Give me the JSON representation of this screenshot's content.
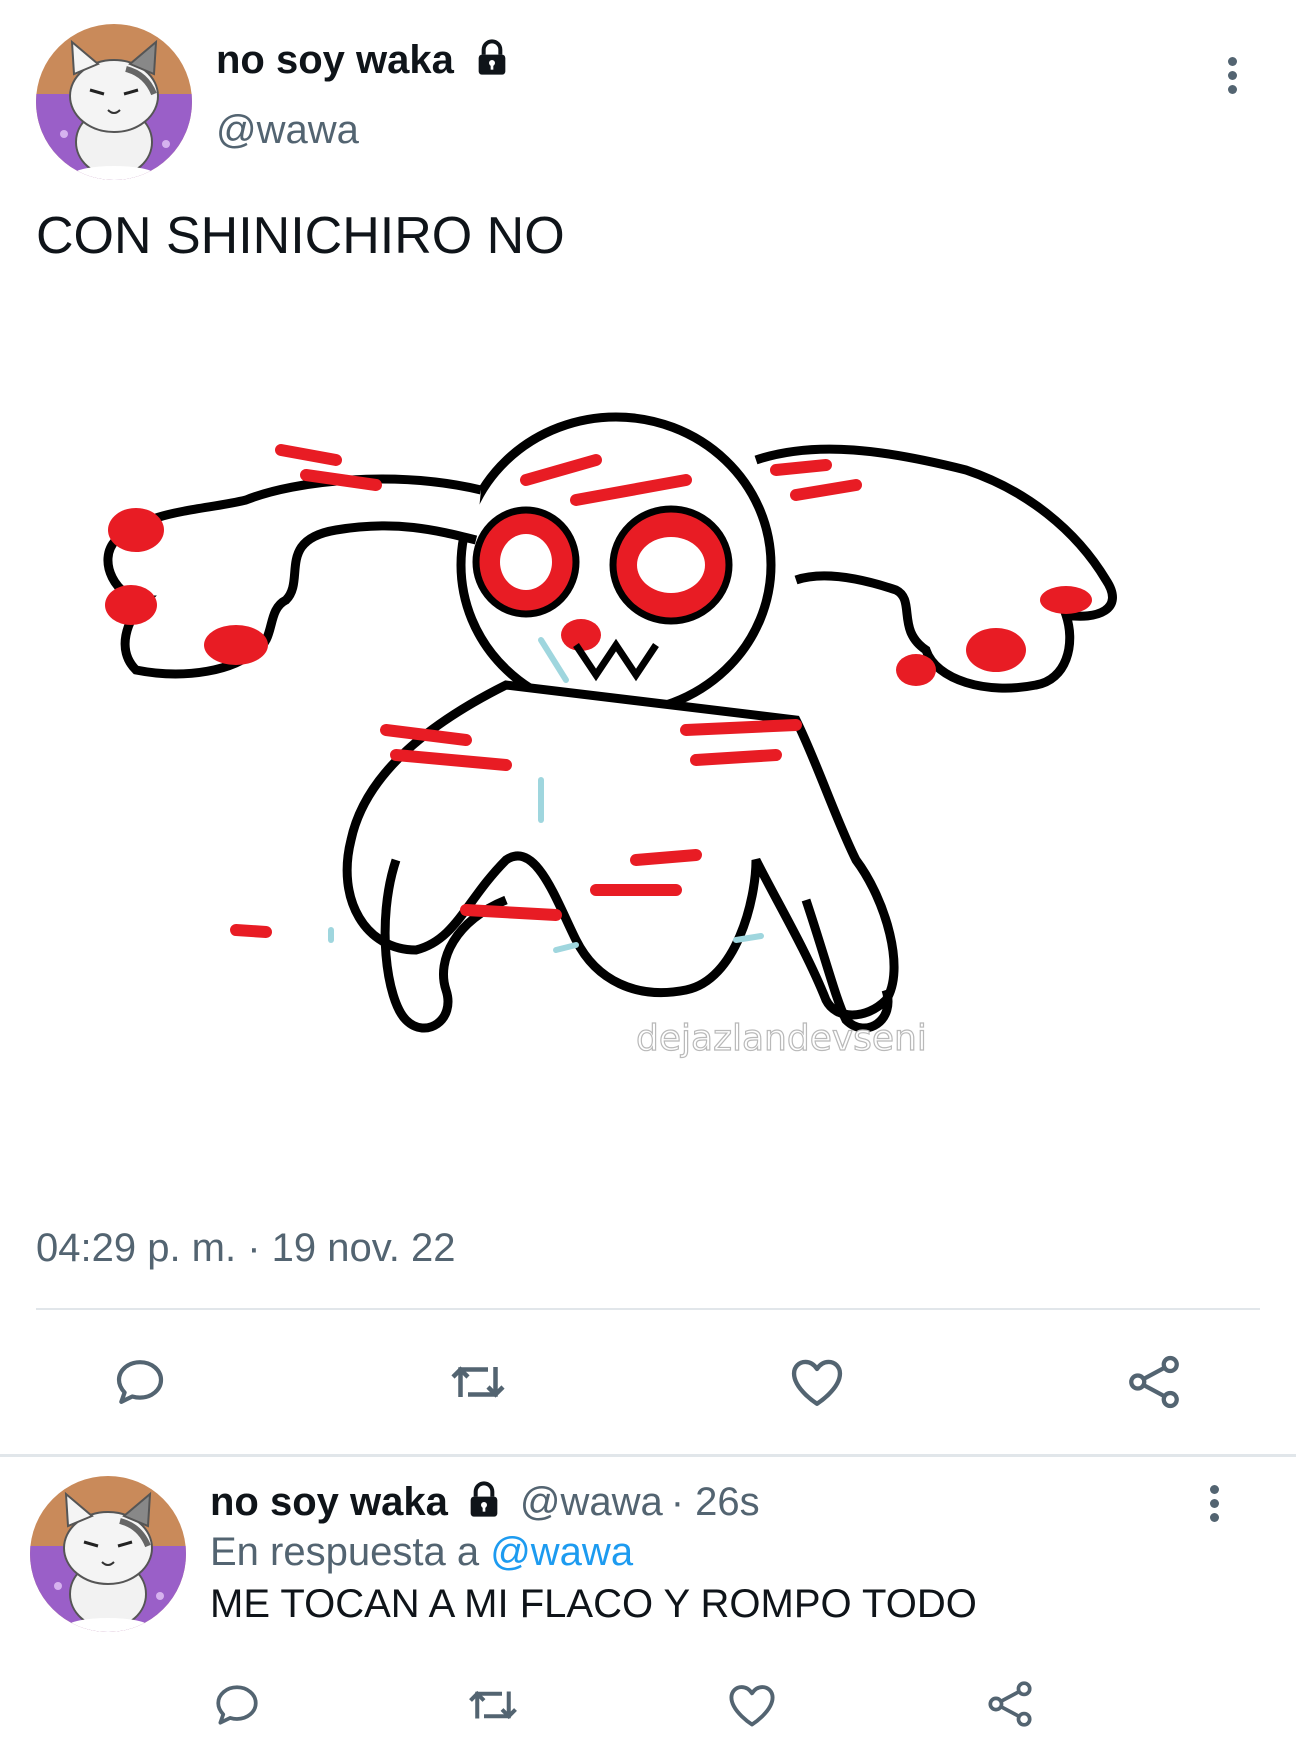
{
  "main_tweet": {
    "display_name": "no soy waka",
    "handle": "@wawa",
    "text": "CON SHINICHIRO NO",
    "image_watermark": "dejazlandevseni",
    "timestamp": "04:29 p. m. · 19 nov. 22",
    "actions": [
      "reply-icon",
      "retweet-icon",
      "like-icon",
      "share-icon"
    ]
  },
  "reply_tweet": {
    "display_name": "no soy waka",
    "handle": "@wawa",
    "age": "· 26s",
    "reply_prefix": "En respuesta a",
    "reply_to": "@wawa",
    "text": "ME TOCAN A MI FLACO Y ROMPO TODO",
    "actions": [
      "reply-icon",
      "retweet-icon",
      "like-icon",
      "share-icon"
    ]
  },
  "colors": {
    "text": "#0f1419",
    "secondary": "#536471",
    "link": "#1d9bf0",
    "divider": "#e1e6ea",
    "drawing_red": "#e81c24",
    "avatar_purple": "#9a5fc8"
  }
}
